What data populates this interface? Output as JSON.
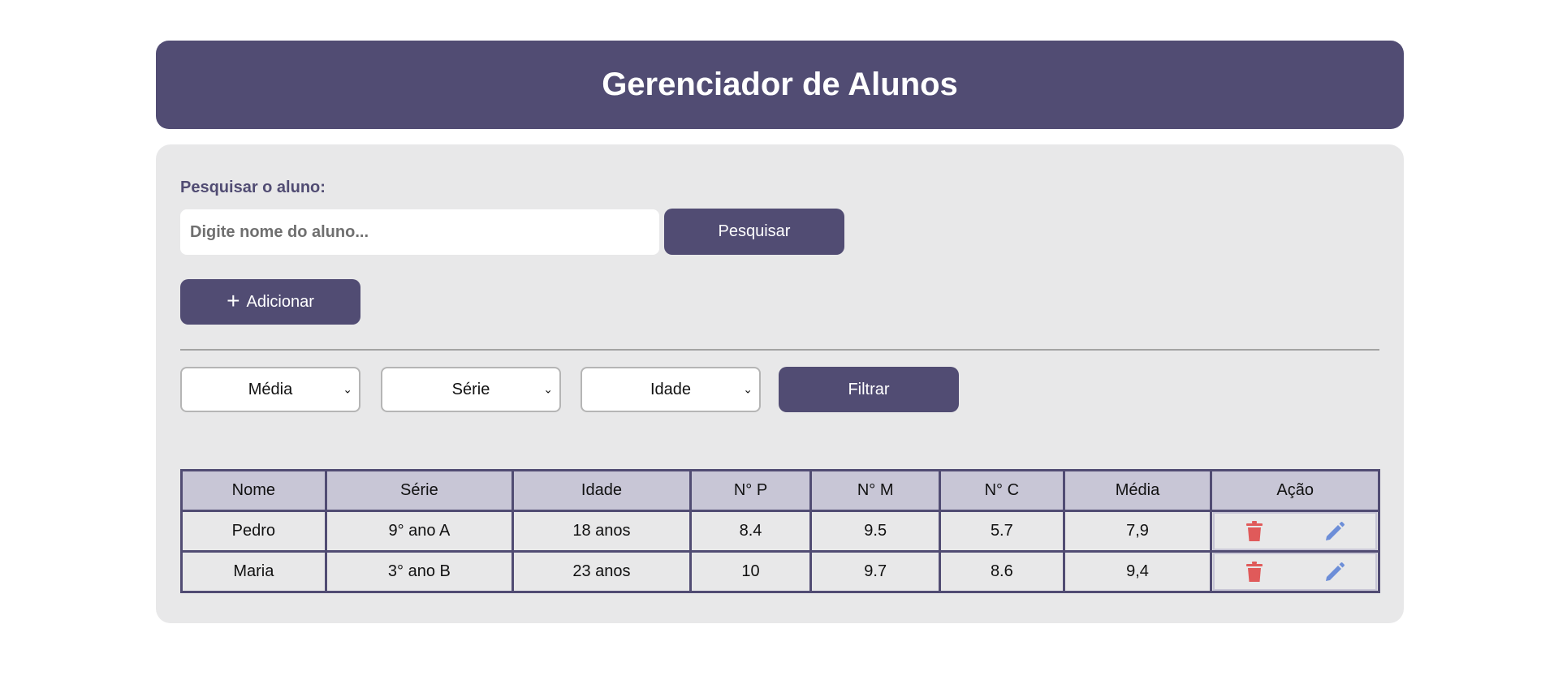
{
  "header": {
    "title": "Gerenciador de Alunos"
  },
  "search": {
    "label": "Pesquisar o aluno:",
    "placeholder": "Digite nome do aluno...",
    "button_label": "Pesquisar"
  },
  "add_button": {
    "label": "Adicionar",
    "icon": "plus-icon"
  },
  "filters": {
    "media": "Média",
    "serie": "Série",
    "idade": "Idade",
    "button_label": "Filtrar"
  },
  "table": {
    "headers": [
      "Nome",
      "Série",
      "Idade",
      "N° P",
      "N° M",
      "N° C",
      "Média",
      "Ação"
    ],
    "rows": [
      {
        "nome": "Pedro",
        "serie": "9° ano A",
        "idade": "18 anos",
        "np": "8.4",
        "nm": "9.5",
        "nc": "5.7",
        "media": "7,9"
      },
      {
        "nome": "Maria",
        "serie": "3° ano B",
        "idade": "23 anos",
        "np": "10",
        "nm": "9.7",
        "nc": "8.6",
        "media": "9,4"
      }
    ],
    "action_icons": [
      "trash-icon",
      "pencil-icon"
    ]
  },
  "colors": {
    "primary": "#514c73",
    "panel_bg": "#e8e8e9",
    "table_header_bg": "#c8c6d6",
    "delete": "#e05a5a",
    "edit": "#6d8ed8"
  }
}
